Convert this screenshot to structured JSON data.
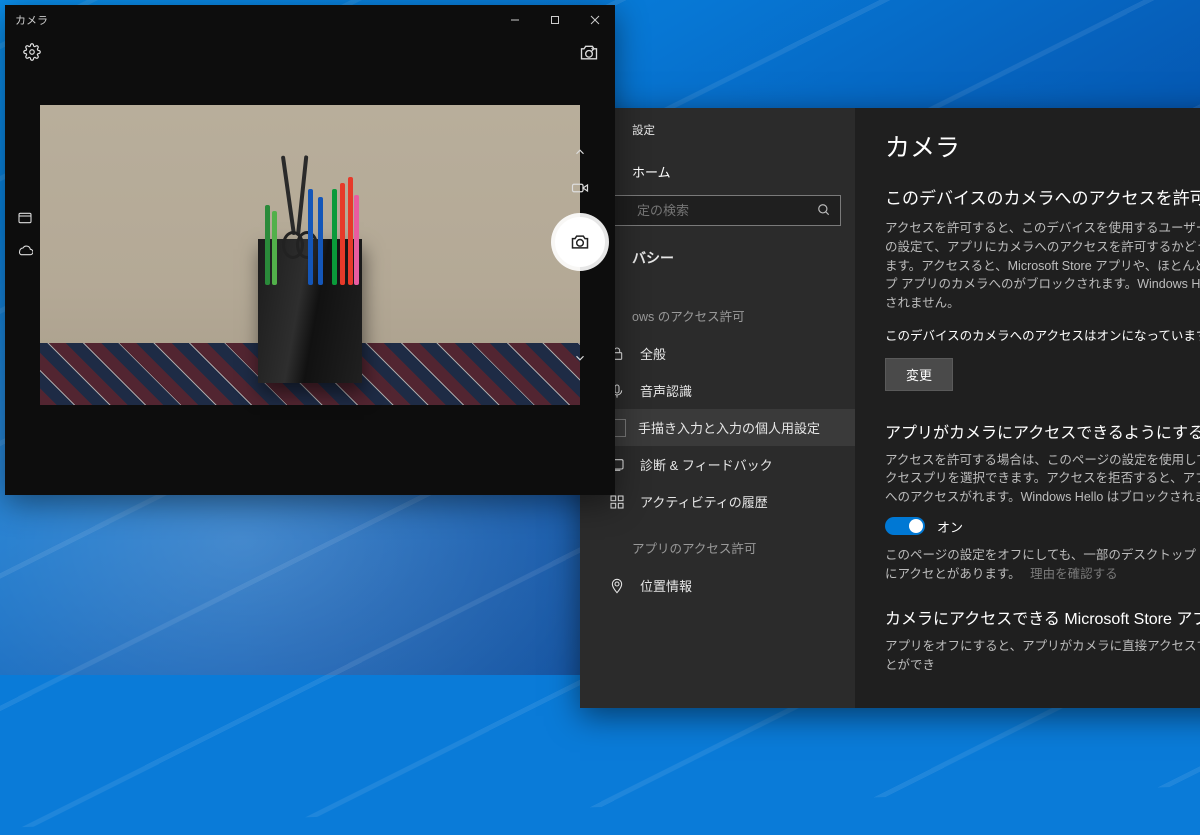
{
  "camera_window": {
    "title": "カメラ"
  },
  "settings": {
    "window_title": "設定",
    "home_label": "ホーム",
    "search_placeholder": "定の検索",
    "category": "バシー",
    "groups": {
      "windows_perm": "ows のアクセス許可",
      "app_perm": "アプリのアクセス許可"
    },
    "nav": {
      "general": "全般",
      "speech": "音声認識",
      "inking": "手描き入力と入力の個人用設定",
      "diagnostics": "診断 & フィードバック",
      "activity": "アクティビティの履歴",
      "location": "位置情報"
    },
    "content": {
      "page_title": "カメラ",
      "section1_heading": "このデバイスのカメラへのアクセスを許可する",
      "section1_desc": "アクセスを許可すると、このデバイスを使用するユーザーはこのページの設定て、アプリにカメラへのアクセスを許可するかどうかを選択できます。アクセスると、Microsoft Store アプリや、ほとんどのデスクトップ アプリのカメラへのがブロックされます。Windows Hello はブロックされません。",
      "section1_status": "このデバイスのカメラへのアクセスはオンになっています",
      "change_button": "変更",
      "section2_heading": "アプリがカメラにアクセスできるようにする",
      "section2_desc": "アクセスを許可する場合は、このページの設定を使用して、カメラにアクセスプリを選択できます。アクセスを拒否すると、アプリからカメラへのアクセスがれます。Windows Hello はブロックされません。",
      "toggle_label": "オン",
      "section2_note": "このページの設定をオフにしても、一部のデスクトップ アプリがカメラにアクセとがあります。",
      "section2_note_link": "理由を確認する",
      "section3_heading": "カメラにアクセスできる Microsoft Store アプリを選",
      "section3_desc": "アプリをオフにすると、アプリがカメラに直接アクセスするのを防ぐことができ"
    }
  }
}
